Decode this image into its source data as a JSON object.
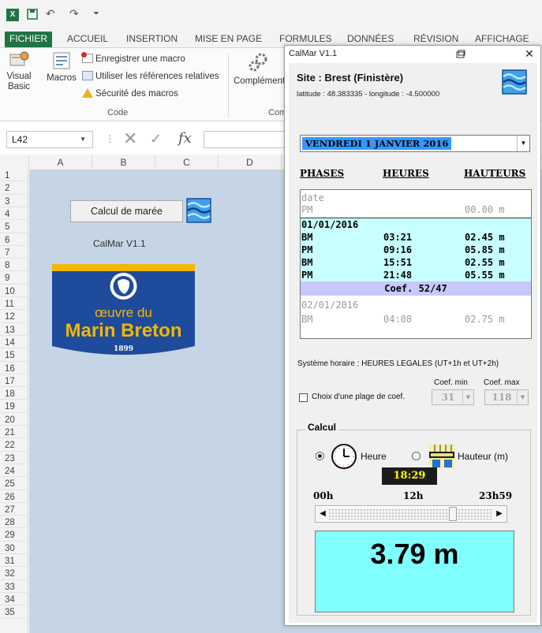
{
  "excel": {
    "tabs": [
      "FICHIER",
      "ACCUEIL",
      "INSERTION",
      "MISE EN PAGE",
      "FORMULES",
      "DONNÉES",
      "RÉVISION",
      "AFFICHAGE"
    ],
    "ribbon": {
      "visual_basic": [
        "Visual",
        "Basic"
      ],
      "macros": "Macros",
      "record_macro": "Enregistrer une macro",
      "relative_refs": "Utiliser les références relatives",
      "macro_security": "Sécurité des macros",
      "code_group": "Code",
      "complements": "Compléments",
      "complements_group": "Com"
    },
    "name_box": "L42",
    "fx": "fx",
    "columns": [
      "A",
      "B",
      "C",
      "D"
    ],
    "rows": [
      "1",
      "2",
      "3",
      "4",
      "5",
      "6",
      "7",
      "8",
      "9",
      "10",
      "11",
      "12",
      "13",
      "14",
      "15",
      "16",
      "17",
      "18",
      "19",
      "20",
      "21",
      "22",
      "23",
      "24",
      "25",
      "26",
      "27",
      "28",
      "29",
      "30",
      "31",
      "32",
      "33",
      "34",
      "35"
    ]
  },
  "sheet": {
    "calc_button": "Calcul de marée",
    "version": "CalMar V1.1",
    "logo": {
      "line1": "œuvre du",
      "line2": "Marin Breton",
      "year": "1899"
    }
  },
  "dialog": {
    "title": "CalMar V1.1",
    "site": "Site : Brest (Finistère)",
    "coords": "latitude : 48.383335 - longitude : -4.500000",
    "selected_date": "VENDREDI 1 JANVIER 2016",
    "headers": {
      "phases": "PHASES",
      "heures": "HEURES",
      "hauteurs": "HAUTEURS"
    },
    "prev_block": {
      "label": "date",
      "phase": "PM",
      "height": "00.00 m"
    },
    "day1": {
      "date": "01/01/2016",
      "rows": [
        {
          "phase": "BM",
          "time": "03:21",
          "height": "02.45 m"
        },
        {
          "phase": "PM",
          "time": "09:16",
          "height": "05.85 m"
        },
        {
          "phase": "BM",
          "time": "15:51",
          "height": "02.55 m"
        },
        {
          "phase": "PM",
          "time": "21:48",
          "height": "05.55 m"
        }
      ],
      "coef": "Coef. 52/47"
    },
    "day2": {
      "date": "02/01/2016",
      "rows": [
        {
          "phase": "BM",
          "time": "04:08",
          "height": "02.75 m"
        }
      ]
    },
    "time_system": "Système horaire : HEURES LEGALES (UT+1h et UT+2h)",
    "coef_min_label": "Coef. min",
    "coef_max_label": "Coef. max",
    "coef_range_checkbox": "Choix d'une plage de coef.",
    "coef_range_checked": false,
    "coef_min": "31",
    "coef_max": "118",
    "calc_frame": "Calcul",
    "mode_heure": "Heure",
    "mode_hauteur": "Hauteur (m)",
    "mode_selected": "heure",
    "time": "18:29",
    "scale_start": "00h",
    "scale_mid": "12h",
    "scale_end": "23h59",
    "slider_fraction": 0.77,
    "result": "3.79 m",
    "colors": {
      "result_bg": "#80ffff",
      "day_bg": "#c8ffff",
      "coef_bg": "#c8c8ff",
      "selection": "#3399ff",
      "sheet_bg": "#c6d5e6",
      "logo_blue": "#1e4b9b",
      "logo_gold": "#f2b705"
    }
  }
}
